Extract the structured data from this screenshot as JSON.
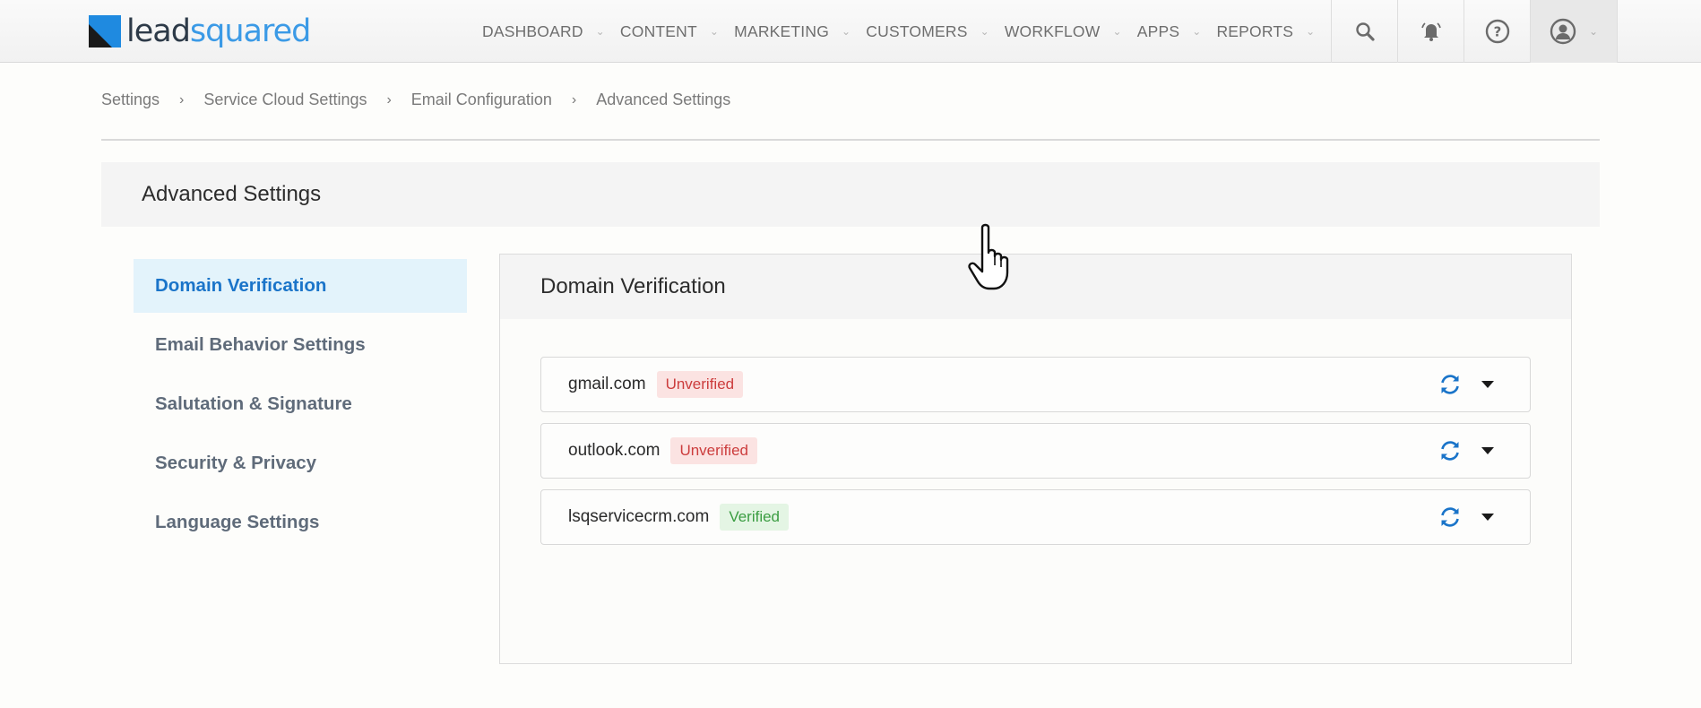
{
  "header": {
    "logo": {
      "part1": "lead",
      "part2": "squared",
      "mark_color": "#1f8ae0"
    },
    "nav": [
      {
        "label": "DASHBOARD"
      },
      {
        "label": "CONTENT"
      },
      {
        "label": "MARKETING"
      },
      {
        "label": "CUSTOMERS"
      },
      {
        "label": "WORKFLOW"
      },
      {
        "label": "APPS"
      },
      {
        "label": "REPORTS"
      }
    ],
    "icons": [
      "search-icon",
      "notification-bell-icon",
      "help-icon",
      "user-avatar-icon"
    ]
  },
  "breadcrumb": [
    "Settings",
    "Service Cloud Settings",
    "Email Configuration",
    "Advanced Settings"
  ],
  "page": {
    "title": "Advanced Settings"
  },
  "sidebar": {
    "items": [
      {
        "label": "Domain Verification",
        "active": true
      },
      {
        "label": "Email Behavior Settings"
      },
      {
        "label": "Salutation & Signature"
      },
      {
        "label": "Security & Privacy"
      },
      {
        "label": "Language Settings"
      }
    ]
  },
  "panel": {
    "title": "Domain Verification",
    "domains": [
      {
        "name": "gmail.com",
        "status": "Unverified"
      },
      {
        "name": "outlook.com",
        "status": "Unverified"
      },
      {
        "name": "lsqservicecrm.com",
        "status": "Verified"
      }
    ]
  },
  "colors": {
    "accent": "#1a74c9",
    "unverified": "#cc3d3d",
    "verified": "#3b9d42"
  }
}
